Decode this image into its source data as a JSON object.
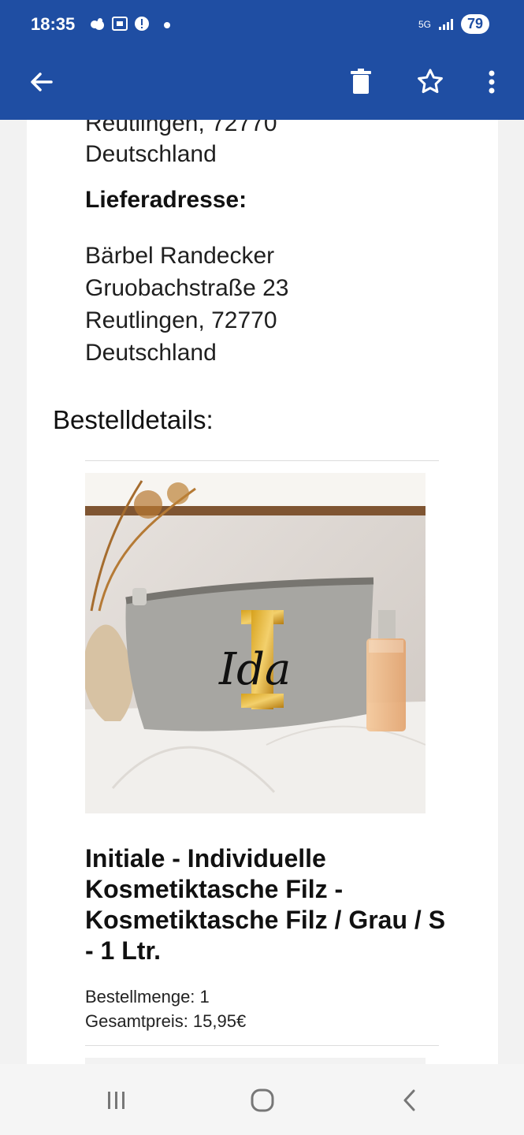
{
  "status": {
    "time": "18:35",
    "network": "5G",
    "battery": "79"
  },
  "toolbar": {
    "back_icon": "arrow-left-icon",
    "delete_icon": "trash-icon",
    "star_icon": "star-icon",
    "more_icon": "more-vertical-icon"
  },
  "address_top": {
    "city_line": "Reutlingen, 72770",
    "country": "Deutschland"
  },
  "delivery": {
    "heading": "Lieferadresse:",
    "name": "Bärbel Randecker",
    "street": "Gruobachstraße 23",
    "city": "Reutlingen, 72770",
    "country": "Deutschland"
  },
  "order": {
    "title": "Bestelldetails:",
    "item": {
      "image_text": "Ida",
      "image_initial": "I",
      "name": "Initiale - Individuelle Kosmetiktasche Filz - Kosmetiktasche Filz / Grau / S - 1 Ltr.",
      "quantity": "Bestellmenge: 1",
      "total": "Gesamtpreis: 15,95€"
    }
  }
}
